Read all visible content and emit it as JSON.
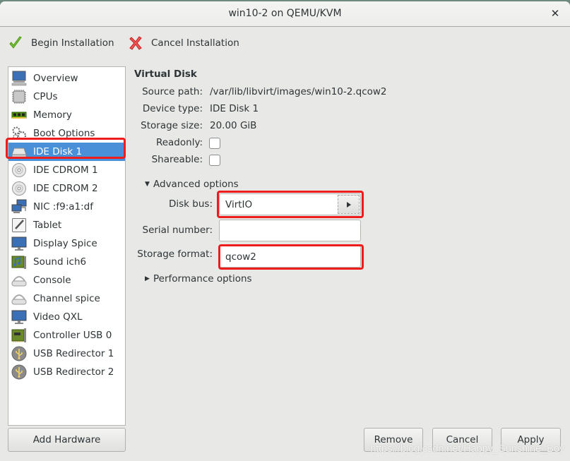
{
  "window": {
    "title": "win10-2 on QEMU/KVM",
    "close_glyph": "✕"
  },
  "toolbar": {
    "begin_installation": "Begin Installation",
    "cancel_installation": "Cancel Installation"
  },
  "hardware_list": {
    "selected_index": 4,
    "items": [
      {
        "label": "Overview",
        "icon": "monitor-computer-icon"
      },
      {
        "label": "CPUs",
        "icon": "cpu-chip-icon"
      },
      {
        "label": "Memory",
        "icon": "memory-module-icon"
      },
      {
        "label": "Boot Options",
        "icon": "gears-icon"
      },
      {
        "label": "IDE Disk 1",
        "icon": "hard-disk-icon"
      },
      {
        "label": "IDE CDROM 1",
        "icon": "cdrom-icon"
      },
      {
        "label": "IDE CDROM 2",
        "icon": "cdrom-icon"
      },
      {
        "label": "NIC :f9:a1:df",
        "icon": "network-icon"
      },
      {
        "label": "Tablet",
        "icon": "tablet-icon"
      },
      {
        "label": "Display Spice",
        "icon": "display-icon"
      },
      {
        "label": "Sound ich6",
        "icon": "sound-card-icon"
      },
      {
        "label": "Console",
        "icon": "serial-port-icon"
      },
      {
        "label": "Channel spice",
        "icon": "serial-port-icon"
      },
      {
        "label": "Video QXL",
        "icon": "display-icon"
      },
      {
        "label": "Controller USB 0",
        "icon": "controller-card-icon"
      },
      {
        "label": "USB Redirector 1",
        "icon": "usb-icon"
      },
      {
        "label": "USB Redirector 2",
        "icon": "usb-icon"
      }
    ]
  },
  "details": {
    "section_title": "Virtual Disk",
    "source_path_label": "Source path:",
    "source_path_value": "/var/lib/libvirt/images/win10-2.qcow2",
    "device_type_label": "Device type:",
    "device_type_value": "IDE Disk 1",
    "storage_size_label": "Storage size:",
    "storage_size_value": "20.00 GiB",
    "readonly_label": "Readonly:",
    "readonly_checked": false,
    "shareable_label": "Shareable:",
    "shareable_checked": false,
    "advanced": {
      "label": "Advanced options",
      "expanded": true,
      "disk_bus_label": "Disk bus:",
      "disk_bus_value": "VirtIO",
      "serial_number_label": "Serial number:",
      "serial_number_value": "",
      "storage_format_label": "Storage format:",
      "storage_format_value": "qcow2"
    },
    "performance": {
      "label": "Performance options",
      "expanded": false
    }
  },
  "buttons": {
    "add_hardware": "Add Hardware",
    "remove": "Remove",
    "cancel": "Cancel",
    "apply": "Apply"
  },
  "annotation": {
    "highlight_color": "#ee1c1c",
    "selection_color": "#4a90d9"
  },
  "watermark": "https://blog.csdn.net/Happy_Sunshine_Boy"
}
